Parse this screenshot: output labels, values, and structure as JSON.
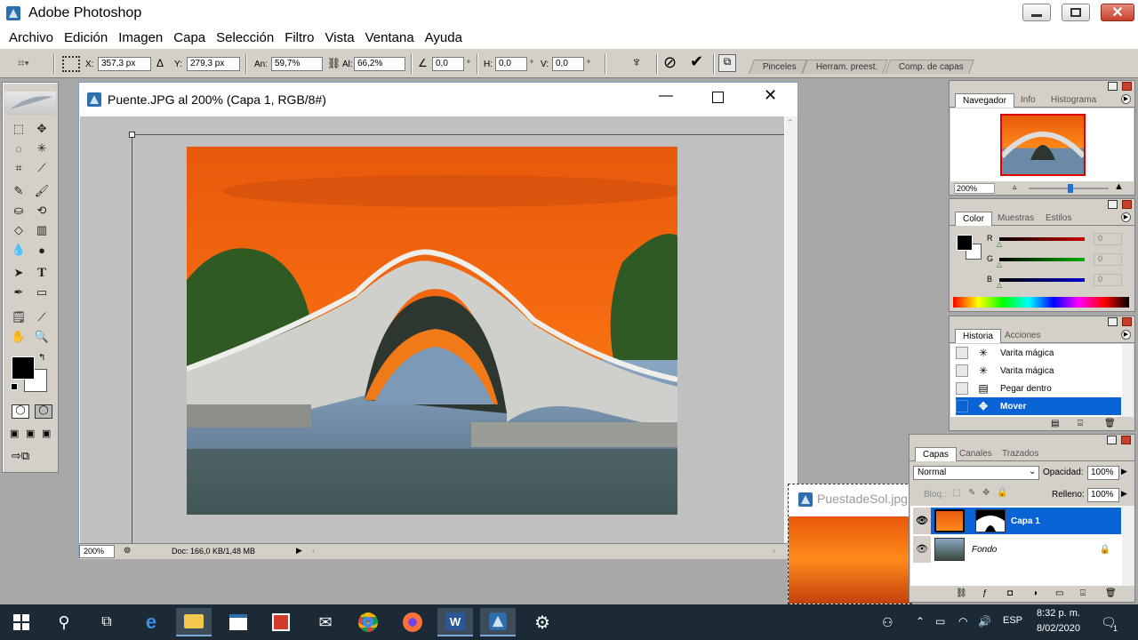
{
  "app": {
    "title": "Adobe Photoshop",
    "window_buttons": [
      "minimize",
      "restore",
      "close"
    ]
  },
  "menu": [
    "Archivo",
    "Edición",
    "Imagen",
    "Capa",
    "Selección",
    "Filtro",
    "Vista",
    "Ventana",
    "Ayuda"
  ],
  "options": {
    "x_label": "X:",
    "x_value": "357,3 px",
    "y_label": "Y:",
    "y_value": "279,3 px",
    "w_label": "An:",
    "w_value": "59,7%",
    "h_label": "Al:",
    "h_value": "66,2%",
    "angle_value": "0,0",
    "hskew_label": "H:",
    "hskew_value": "0,0",
    "vskew_label": "V:",
    "vskew_value": "0,0",
    "deg": "°",
    "well_tabs": [
      "Pinceles",
      "Herram. preest.",
      "Comp. de capas"
    ]
  },
  "document": {
    "title": "Puente.JPG al 200% (Capa 1, RGB/8#)",
    "zoom": "200%",
    "doc_info": "Doc: 166,0 KB/1,48 MB"
  },
  "bg_document": {
    "title": "PuestadeSol.jpg"
  },
  "navigator": {
    "tabs": [
      "Navegador",
      "Info",
      "Histograma"
    ],
    "zoom": "200%"
  },
  "color": {
    "tabs": [
      "Color",
      "Muestras",
      "Estilos"
    ],
    "channels": [
      {
        "label": "R",
        "value": "0",
        "color": "#d00000"
      },
      {
        "label": "G",
        "value": "0",
        "color": "#00b000"
      },
      {
        "label": "B",
        "value": "0",
        "color": "#0000d0"
      }
    ]
  },
  "history": {
    "tabs": [
      "Historia",
      "Acciones"
    ],
    "items": [
      {
        "label": "Varita mágica",
        "icon": "magic-wand-icon"
      },
      {
        "label": "Varita mágica",
        "icon": "magic-wand-icon"
      },
      {
        "label": "Pegar dentro",
        "icon": "paste-into-icon"
      },
      {
        "label": "Mover",
        "icon": "move-icon",
        "selected": true
      }
    ]
  },
  "layers": {
    "tabs": [
      "Capas",
      "Canales",
      "Trazados"
    ],
    "blend_mode": "Normal",
    "opacity_label": "Opacidad:",
    "opacity_value": "100%",
    "lock_label": "Bloq.:",
    "fill_label": "Relleno:",
    "fill_value": "100%",
    "items": [
      {
        "name": "Capa 1",
        "selected": true
      },
      {
        "name": "Fondo",
        "locked": true
      }
    ]
  },
  "taskbar": {
    "lang": "ESP",
    "time": "8:32 p. m.",
    "date": "8/02/2020",
    "notifications": "1"
  },
  "colors": {
    "selection_blue": "#0a64d6",
    "sky_orange": "#f26a10",
    "taskbar_bg": "#1c2a35"
  }
}
